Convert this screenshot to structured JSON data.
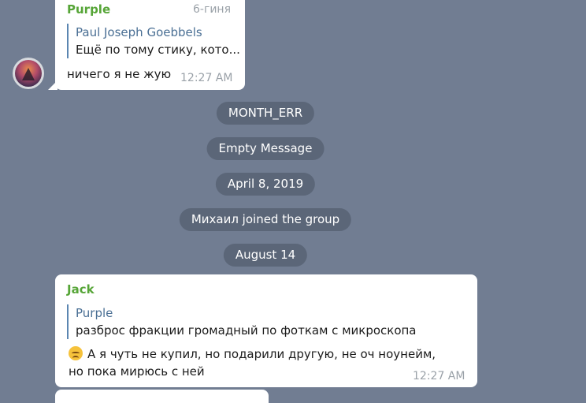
{
  "top_message": {
    "sender": "Purple",
    "date": "6-гиня",
    "reply_name": "Paul Joseph Goebbels",
    "reply_text": "Ещё по тому стику, кото...",
    "text": "ничего я не жую",
    "time": "12:27 AM"
  },
  "service_messages": [
    "MONTH_ERR",
    "Empty Message",
    "April 8, 2019",
    "Михаил joined the group",
    "August 14"
  ],
  "jack_message": {
    "sender": "Jack",
    "reply_name": "Purple",
    "reply_text": "разброс фракции громадный по фоткам с микроскопа",
    "emoji": "disappointed-face",
    "text": "А я чуть не купил, но подарили другую, не оч ноунейм, но пока мирюсь с ней",
    "time": "12:27 AM"
  },
  "colors": {
    "background": "#717d92",
    "bubble": "#ffffff",
    "sender_green": "#56a537",
    "reply_blue": "#4a6f94",
    "pill": "#5b6678",
    "time_gray": "#9aa1a8"
  }
}
